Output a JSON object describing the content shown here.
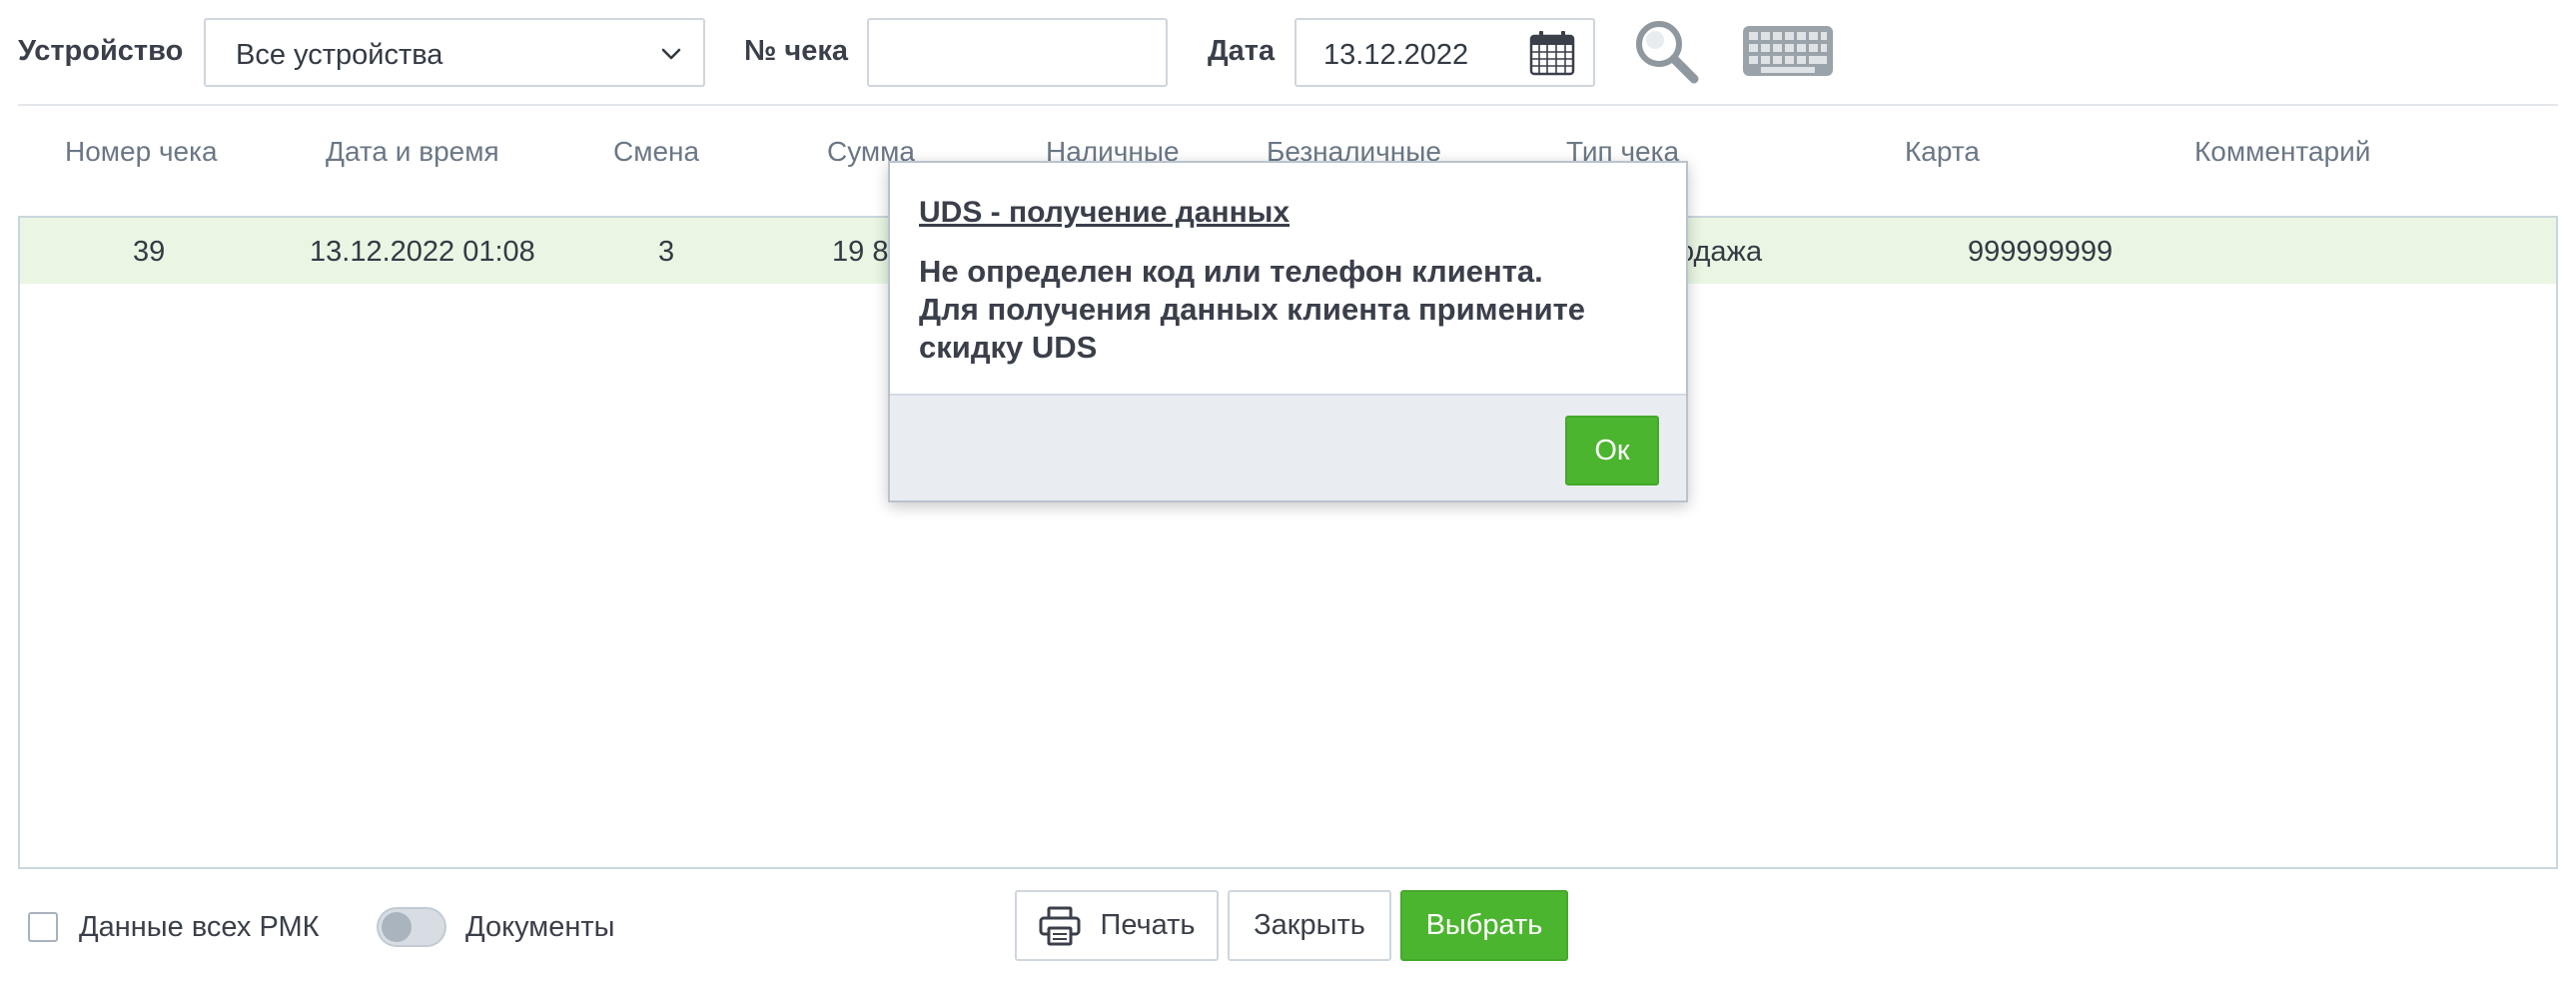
{
  "toolbar": {
    "device_label": "Устройство",
    "device_value": "Все устройства",
    "receipt_label": "№ чека",
    "receipt_value": "",
    "date_label": "Дата",
    "date_value": "13.12.2022"
  },
  "table": {
    "columns": [
      "Номер чека",
      "Дата и время",
      "Смена",
      "Сумма",
      "Наличные",
      "Безналичные",
      "Тип чека",
      "Карта",
      "Комментарий"
    ],
    "rows": [
      {
        "number": "39",
        "datetime": "13.12.2022 01:08",
        "shift": "3",
        "sum_visible": "19 8",
        "type_visible": "одажа",
        "card": "999999999",
        "comment": ""
      }
    ],
    "selected_row_color": "#eaf6e3"
  },
  "bottom": {
    "all_rmk_label": "Данные всех РМК",
    "all_rmk_checked": false,
    "documents_label": "Документы",
    "documents_toggle_on": false,
    "print_label": "Печать",
    "close_label": "Закрыть",
    "select_label": "Выбрать"
  },
  "dialog": {
    "title": "UDS - получение данных",
    "message_line1": "Не определен код или телефон клиента.",
    "message_line2": "Для получения данных клиента примените скидку UDS",
    "ok_label": "Ок"
  },
  "colors": {
    "accent_green": "#4cb52f",
    "text": "#3a3f4a",
    "header_text": "#6b7785",
    "border": "#c9d6dd"
  },
  "icons": {
    "device_dropdown": "chevron-down-icon",
    "date_picker": "calendar-icon",
    "search": "search-icon",
    "keyboard": "keyboard-icon",
    "print": "printer-icon"
  }
}
